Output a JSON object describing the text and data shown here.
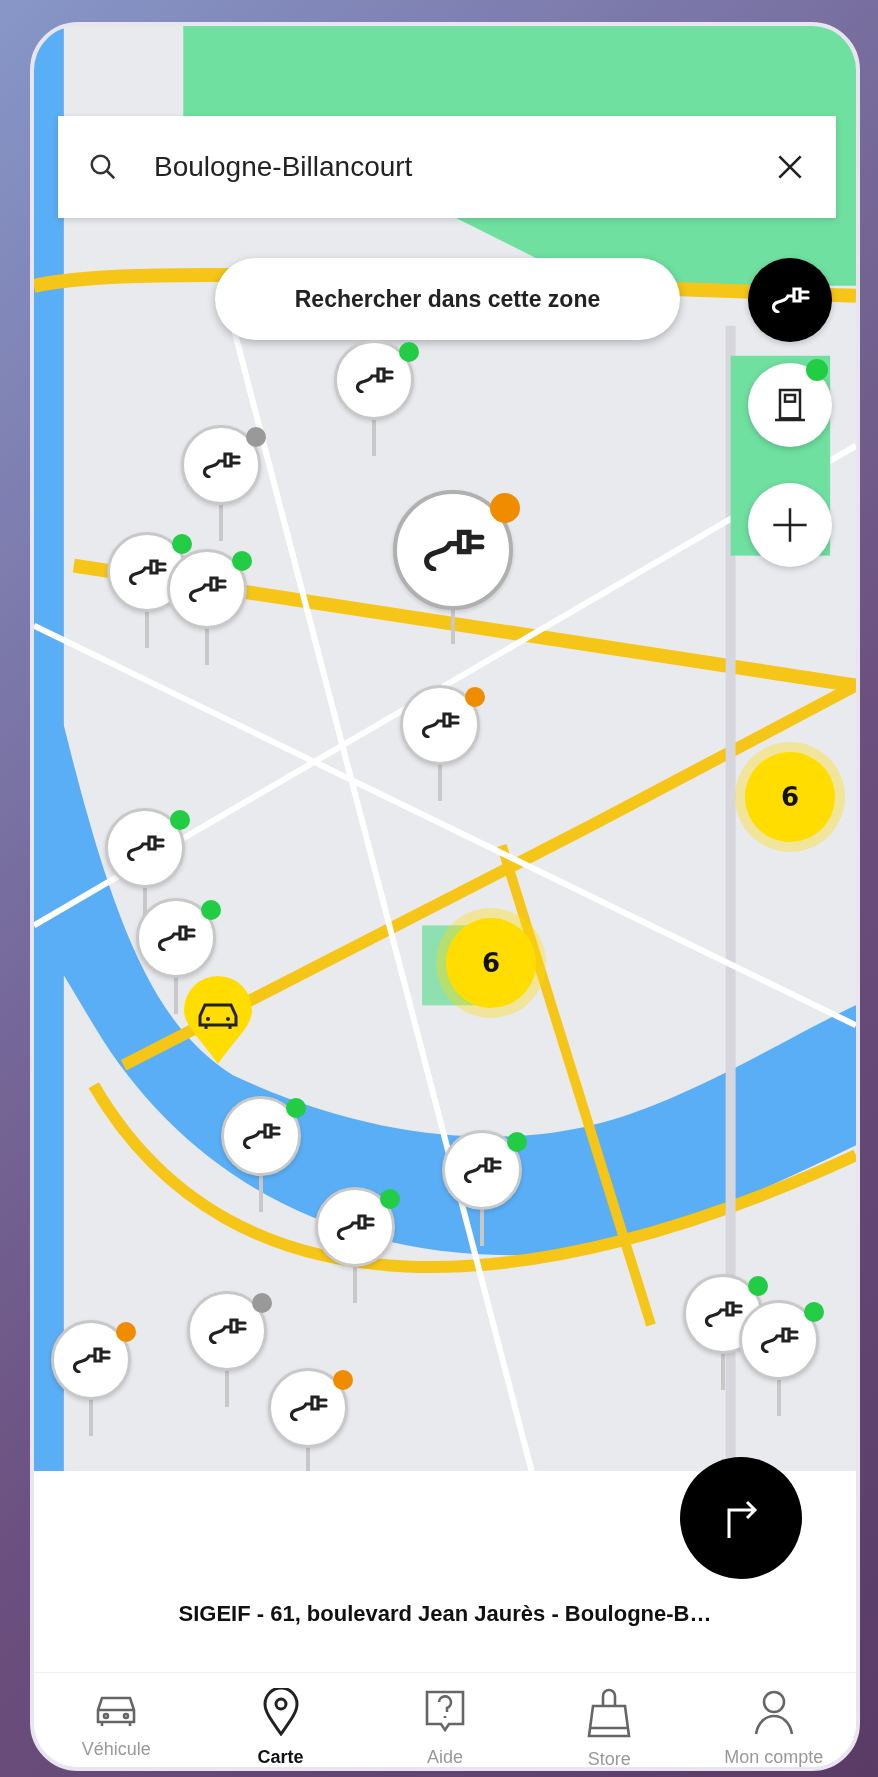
{
  "search": {
    "value": "Boulogne-Billancourt"
  },
  "search_area_button": {
    "label": "Rechercher dans cette zone"
  },
  "map_controls": [
    {
      "kind": "charger-filter",
      "selected": true
    },
    {
      "kind": "station-filter",
      "selected": false,
      "color": "#22cc44"
    },
    {
      "kind": "zoom-in",
      "selected": false
    }
  ],
  "markers": [
    {
      "kind": "station",
      "color": "#22cc44",
      "selected": false
    },
    {
      "kind": "station",
      "color": "#999999",
      "selected": false
    },
    {
      "kind": "station",
      "color": "#22cc44",
      "selected": false
    },
    {
      "kind": "station",
      "color": "#22cc44",
      "selected": false
    },
    {
      "kind": "station",
      "color": "#f08c00",
      "selected": true
    },
    {
      "kind": "station",
      "color": "#f08c00",
      "selected": false
    },
    {
      "kind": "station",
      "color": "#22cc44",
      "selected": false
    },
    {
      "kind": "station",
      "color": "#22cc44",
      "selected": false
    },
    {
      "kind": "cluster",
      "count": "6"
    },
    {
      "kind": "cluster",
      "count": "6"
    },
    {
      "kind": "vehicle"
    },
    {
      "kind": "station",
      "color": "#22cc44",
      "selected": false
    },
    {
      "kind": "station",
      "color": "#22cc44",
      "selected": false
    },
    {
      "kind": "station",
      "color": "#22cc44",
      "selected": false
    },
    {
      "kind": "station",
      "color": "#999999",
      "selected": false
    },
    {
      "kind": "station",
      "color": "#f08c00",
      "selected": false
    },
    {
      "kind": "station",
      "color": "#f08c00",
      "selected": false
    },
    {
      "kind": "station",
      "color": "#22cc44",
      "selected": false
    },
    {
      "kind": "station",
      "color": "#22cc44",
      "selected": false
    }
  ],
  "bottom_sheet": {
    "title": "SIGEIF - 61, boulevard Jean Jaurès - Boulogne-B…"
  },
  "nav": [
    {
      "label": "Véhicule",
      "selected": false
    },
    {
      "label": "Carte",
      "selected": true
    },
    {
      "label": "Aide",
      "selected": false
    },
    {
      "label": "Store",
      "selected": false
    },
    {
      "label": "Mon compte",
      "selected": false
    }
  ]
}
